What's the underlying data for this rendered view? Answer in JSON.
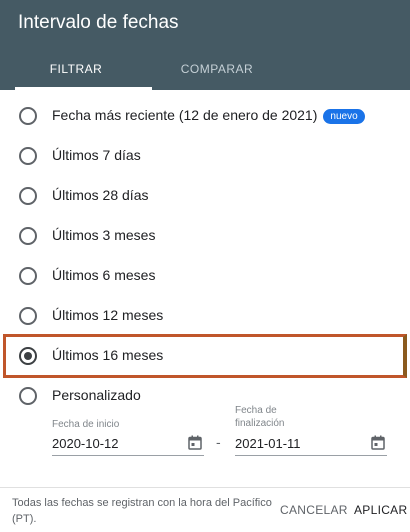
{
  "dialog": {
    "title": "Intervalo de fechas"
  },
  "tabs": [
    {
      "label": "FILTRAR",
      "active": true
    },
    {
      "label": "COMPARAR",
      "active": false
    }
  ],
  "options": [
    {
      "label": "Fecha más reciente (12 de enero de 2021)",
      "badge": "nuevo",
      "selected": false
    },
    {
      "label": "Últimos 7 días",
      "selected": false
    },
    {
      "label": "Últimos 28 días",
      "selected": false
    },
    {
      "label": "Últimos 3 meses",
      "selected": false
    },
    {
      "label": "Últimos 6 meses",
      "selected": false
    },
    {
      "label": "Últimos 12 meses",
      "selected": false
    },
    {
      "label": "Últimos 16 meses",
      "selected": true
    },
    {
      "label": "Personalizado",
      "selected": false
    }
  ],
  "custom_range": {
    "start_label": "Fecha de inicio",
    "start_value": "2020-10-12",
    "end_label": "Fecha de finalización",
    "end_value": "2021-01-11",
    "separator": "-"
  },
  "footer": {
    "note": "Todas las fechas se registran con la hora del Pacífico (PT).",
    "cancel_label": "CANCELAR",
    "apply_label": "APLICAR"
  },
  "colors": {
    "header_bg": "#455a64",
    "highlight_border": "#c0562a",
    "badge_bg": "#1a73e8"
  }
}
